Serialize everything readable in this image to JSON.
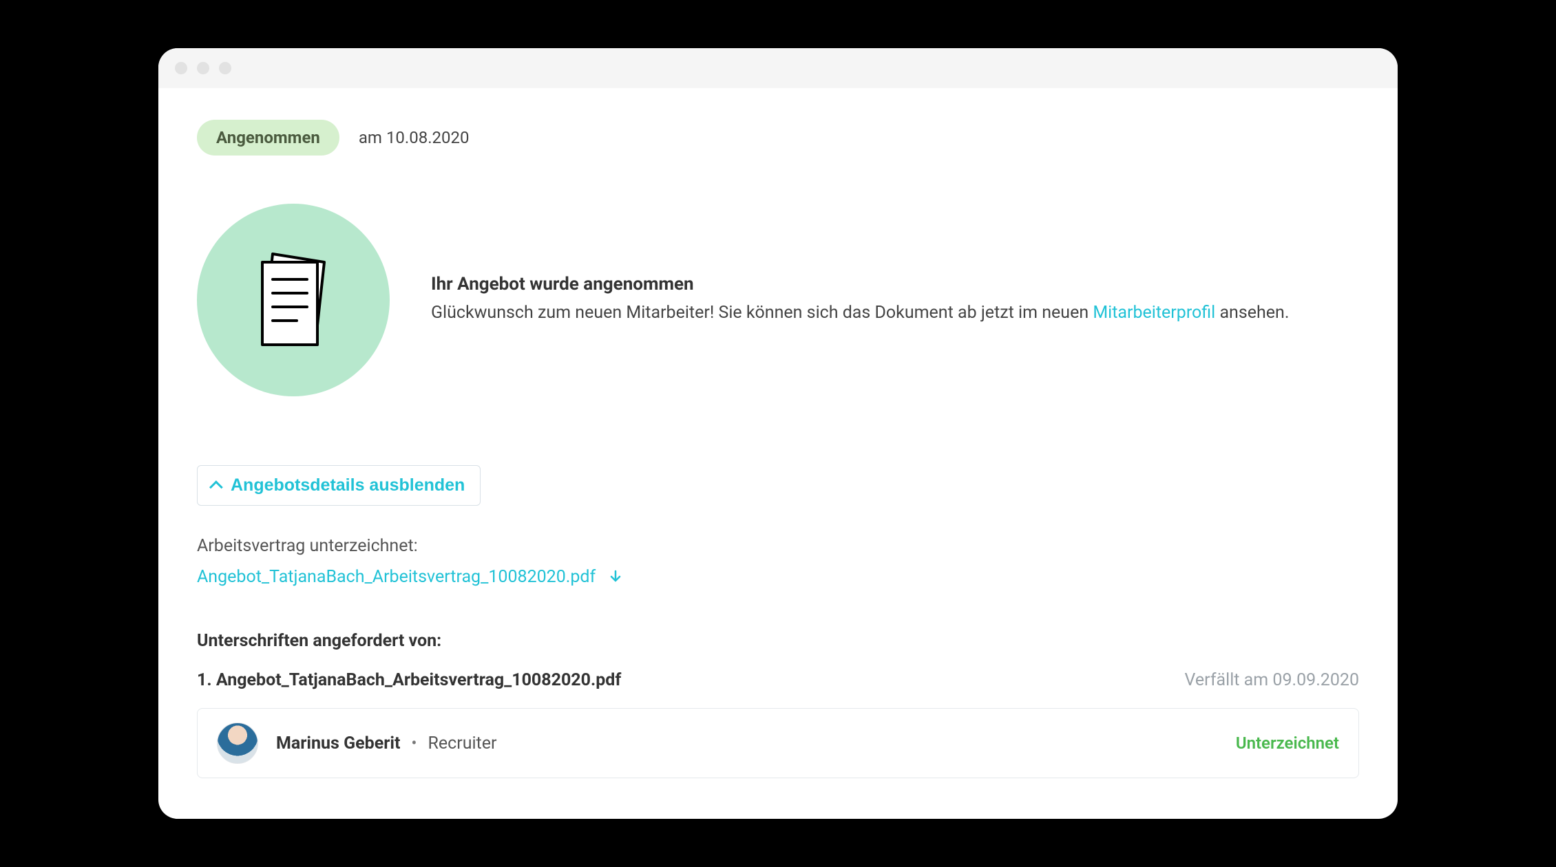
{
  "status": {
    "pill": "Angenommen",
    "date_prefix": "am",
    "date": "10.08.2020"
  },
  "hero": {
    "title": "Ihr Angebot wurde angenommen",
    "body_before_link": "Glückwunsch zum neuen Mitarbeiter! Sie können sich das Dokument ab jetzt im neuen ",
    "link_text": "Mitarbeiterprofil",
    "body_after_link": " ansehen."
  },
  "toggle": {
    "label": "Angebotsdetails ausblenden"
  },
  "contract": {
    "label": "Arbeitsvertrag unterzeichnet:",
    "file": "Angebot_TatjanaBach_Arbeitsvertrag_10082020.pdf"
  },
  "signatures": {
    "header": "Unterschriften angefordert von:",
    "doc_index": "1.",
    "doc_name": "Angebot_TatjanaBach_Arbeitsvertrag_10082020.pdf",
    "expires_prefix": "Verfällt am",
    "expires_date": "09.09.2020",
    "signer": {
      "name": "Marinus Geberit",
      "role": "Recruiter",
      "status": "Unterzeichnet"
    }
  }
}
